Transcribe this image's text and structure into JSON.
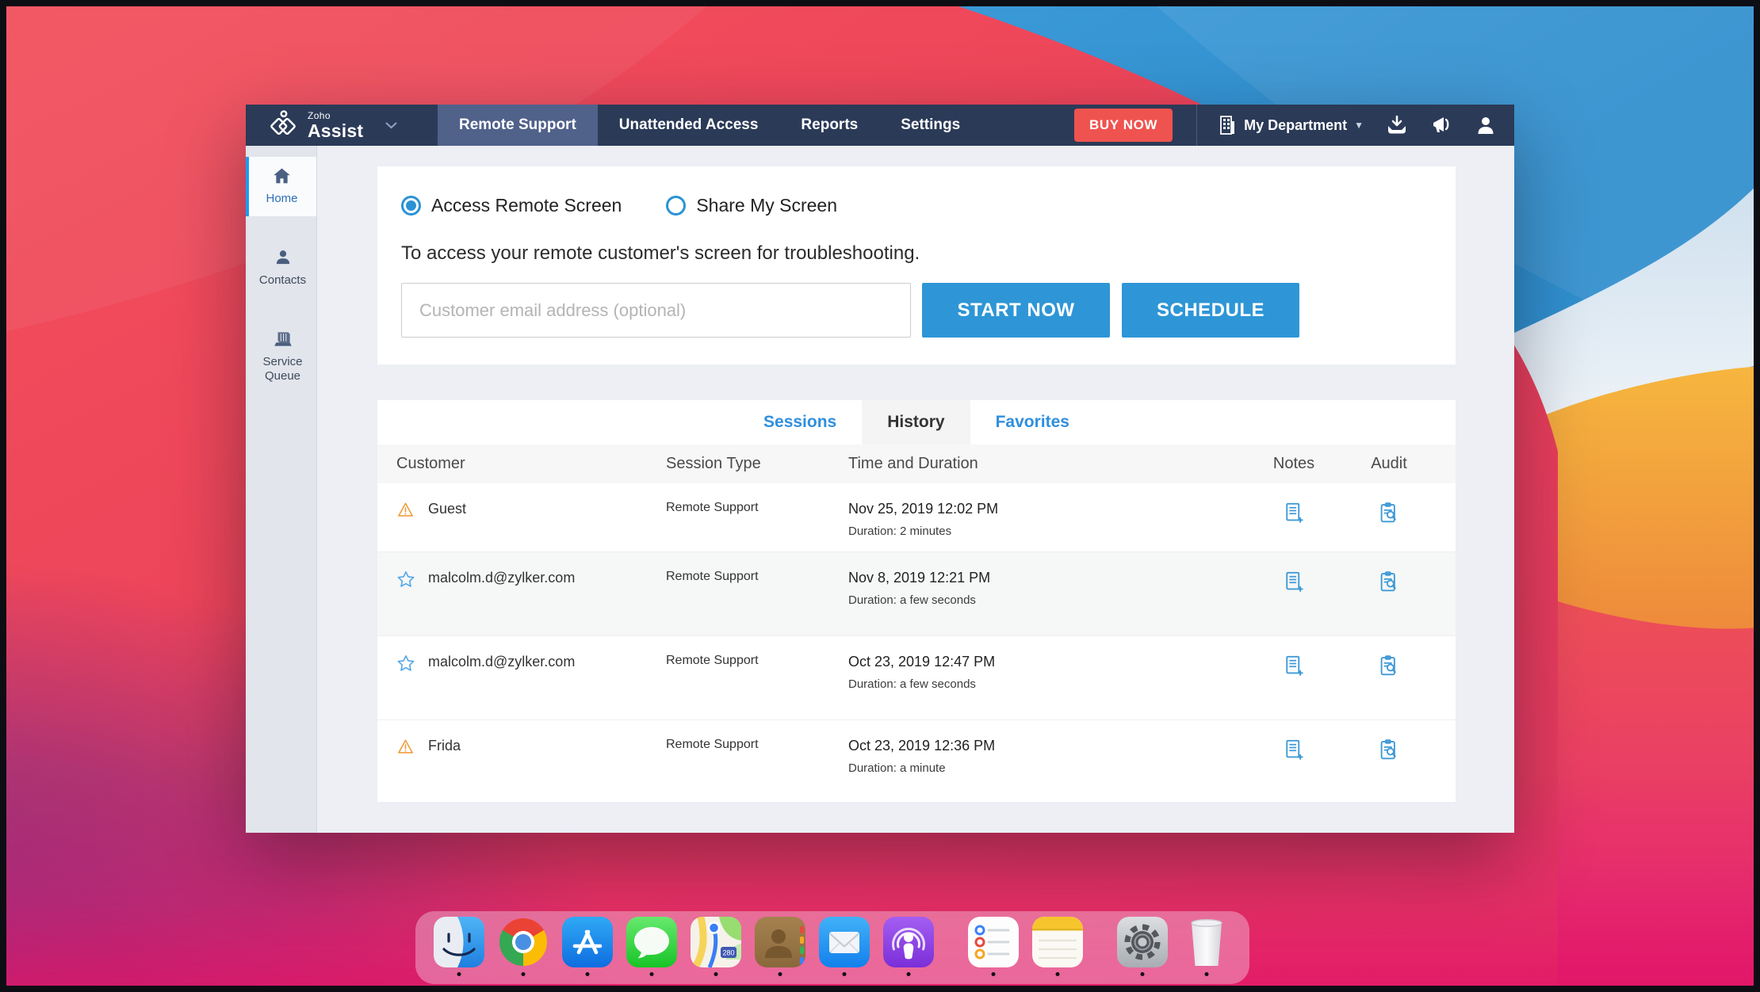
{
  "app": {
    "navbar": {
      "brand": {
        "line1": "Zoho",
        "line2": "Assist"
      },
      "tabs": [
        {
          "label": "Remote Support",
          "active": true
        },
        {
          "label": "Unattended Access",
          "active": false
        },
        {
          "label": "Reports",
          "active": false
        },
        {
          "label": "Settings",
          "active": false
        }
      ],
      "buy_now": "BUY NOW",
      "department": "My Department",
      "icons": [
        "department-building-icon",
        "download-icon",
        "announcement-icon",
        "profile-icon"
      ]
    },
    "sidebar": {
      "items": [
        {
          "label": "Home",
          "icon": "home-icon",
          "active": true
        },
        {
          "label": "Contacts",
          "icon": "contacts-icon",
          "active": false
        },
        {
          "label": "Service Queue",
          "icon": "service-queue-icon",
          "active": false
        }
      ]
    },
    "session_panel": {
      "radio_access": "Access Remote Screen",
      "radio_share": "Share My Screen",
      "selected_radio": "Access Remote Screen",
      "description": "To access your remote customer's screen for troubleshooting.",
      "email_placeholder": "Customer email address (optional)",
      "email_value": "",
      "start_now": "START NOW",
      "schedule": "SCHEDULE"
    },
    "history": {
      "tabs": [
        {
          "label": "Sessions",
          "active": false
        },
        {
          "label": "History",
          "active": true
        },
        {
          "label": "Favorites",
          "active": false
        }
      ],
      "columns": [
        "Customer",
        "Session Type",
        "Time and Duration",
        "Notes",
        "Audit"
      ],
      "rows": [
        {
          "icon": "warning-icon",
          "customer": "Guest",
          "session_type": "Remote Support",
          "time": "Nov 25, 2019 12:02 PM",
          "duration": "Duration: 2 minutes"
        },
        {
          "icon": "favorite-star-icon",
          "customer": "malcolm.d@zylker.com",
          "session_type": "Remote Support",
          "time": "Nov 8, 2019 12:21 PM",
          "duration": "Duration: a few seconds"
        },
        {
          "icon": "favorite-star-icon",
          "customer": "malcolm.d@zylker.com",
          "session_type": "Remote Support",
          "time": "Oct 23, 2019 12:47 PM",
          "duration": "Duration: a few seconds"
        },
        {
          "icon": "warning-icon",
          "customer": "Frida",
          "session_type": "Remote Support",
          "time": "Oct 23, 2019 12:36 PM",
          "duration": "Duration: a minute"
        }
      ],
      "row_actions": [
        "add-note-icon",
        "audit-icon"
      ]
    }
  },
  "dock": {
    "items": [
      "finder",
      "chrome",
      "app-store",
      "messages",
      "maps",
      "contacts",
      "mail",
      "podcasts",
      "reminders",
      "notes",
      "system-preferences",
      "trash"
    ],
    "maps_badge": "280"
  },
  "colors": {
    "navbar": "#2b3a57",
    "navbar_active_tab": "#50618a",
    "accent_blue": "#2e96d6",
    "link_blue": "#2f8fdd",
    "buy_now_red": "#ef5350",
    "warning_orange": "#f09d3f",
    "star_blue": "#53a7e8",
    "sidebar_bg": "#e2e5ec",
    "main_bg": "#edeff4"
  }
}
